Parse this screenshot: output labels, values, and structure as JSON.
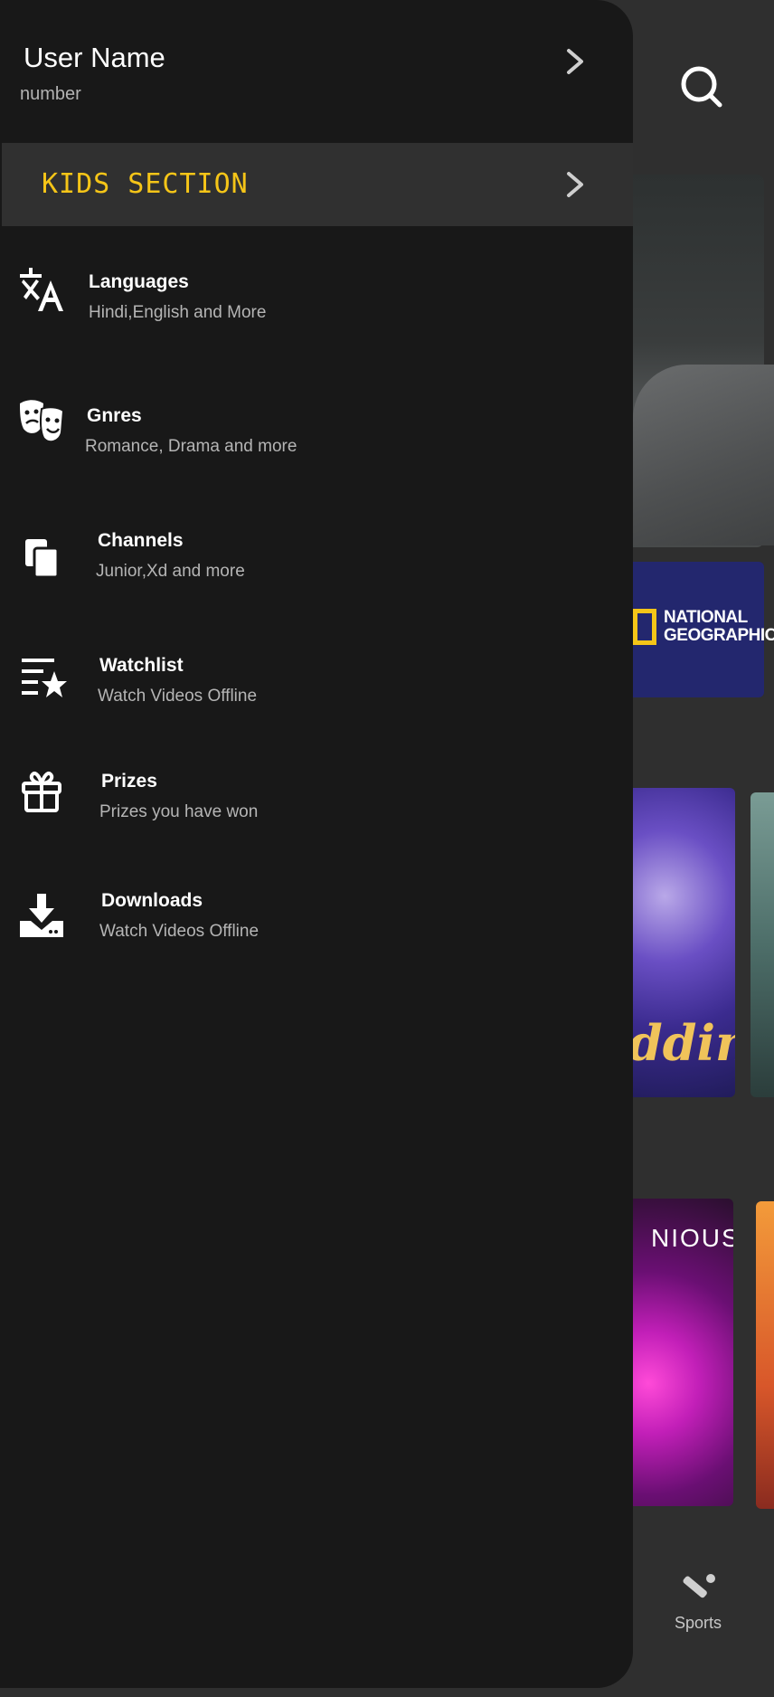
{
  "drawer": {
    "user_name": "User Name",
    "user_number": "number",
    "kids_label": "KIDS SECTION",
    "menu": [
      {
        "title": "Languages",
        "subtitle": "Hindi,English and More",
        "icon": "translate-icon"
      },
      {
        "title": "Gnres",
        "subtitle": "Romance, Drama and more",
        "icon": "theater-masks-icon"
      },
      {
        "title": "Channels",
        "subtitle": "Junior,Xd and more",
        "icon": "copy-icon"
      },
      {
        "title": "Watchlist",
        "subtitle": "Watch Videos Offline",
        "icon": "list-star-icon"
      },
      {
        "title": "Prizes",
        "subtitle": "Prizes you have won",
        "icon": "gift-icon"
      },
      {
        "title": "Downloads",
        "subtitle": "Watch Videos Offline",
        "icon": "download-icon"
      }
    ]
  },
  "background": {
    "banner_logo_line1": "NATIONAL",
    "banner_logo_line2": "GEOGRAPHIC",
    "poster_title_fragment": "ddin",
    "poster2_fragment": "NIOUS",
    "bottom_nav_sports": "Sports"
  },
  "colors": {
    "drawer_bg": "#181818",
    "kids_bg": "#303030",
    "kids_text": "#f5c518",
    "page_bg": "#2f2f2f"
  }
}
